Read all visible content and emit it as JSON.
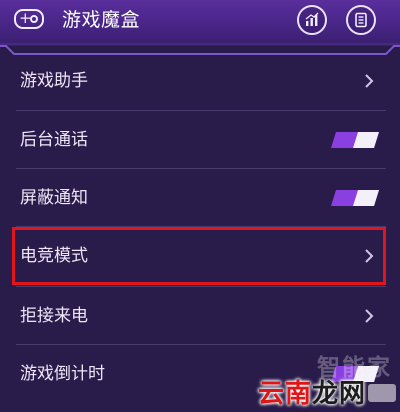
{
  "header": {
    "title": "游戏魔盒",
    "app_icon": "gamepad-icon",
    "stats_icon": "stats-icon",
    "doc_icon": "document-icon"
  },
  "list": {
    "items": [
      {
        "label": "游戏助手",
        "control": "chevron"
      },
      {
        "label": "后台通话",
        "control": "toggle",
        "enabled": true
      },
      {
        "label": "屏蔽通知",
        "control": "toggle",
        "enabled": true
      },
      {
        "label": "电竞模式",
        "control": "chevron",
        "highlighted": true
      },
      {
        "label": "拒接来电",
        "control": "chevron"
      },
      {
        "label": "游戏倒计时",
        "control": "toggle",
        "enabled": true
      }
    ]
  },
  "watermark": {
    "top_text": "智能家",
    "red_text": "云南",
    "dark_text": "龙网"
  },
  "colors": {
    "background": "#2a1c4a",
    "header": "#472586",
    "toggle_on": "#8a3fe0",
    "highlight": "#e0161c"
  }
}
